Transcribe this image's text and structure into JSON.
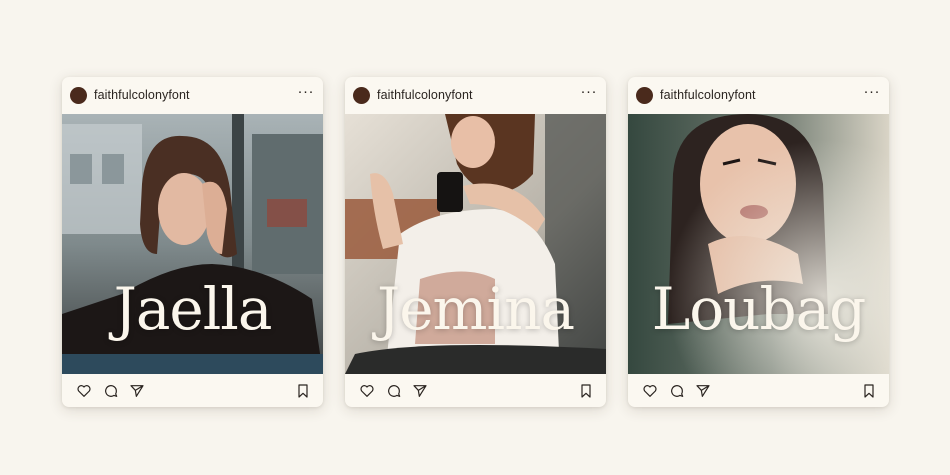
{
  "colors": {
    "background": "#f8f5ee",
    "card": "#fbf8f1",
    "avatar": "#4a2a1c",
    "font_text": "#fbf6ec"
  },
  "posts": [
    {
      "username": "faithfulcolonyfont",
      "word": "Jaella",
      "more": "···",
      "icons": [
        "heart-icon",
        "comment-icon",
        "send-icon",
        "bookmark-icon"
      ]
    },
    {
      "username": "faithfulcolonyfont",
      "word": "Jemina",
      "more": "···",
      "icons": [
        "heart-icon",
        "comment-icon",
        "send-icon",
        "bookmark-icon"
      ]
    },
    {
      "username": "faithfulcolonyfont",
      "word": "Loubag",
      "more": "···",
      "icons": [
        "heart-icon",
        "comment-icon",
        "send-icon",
        "bookmark-icon"
      ]
    }
  ]
}
